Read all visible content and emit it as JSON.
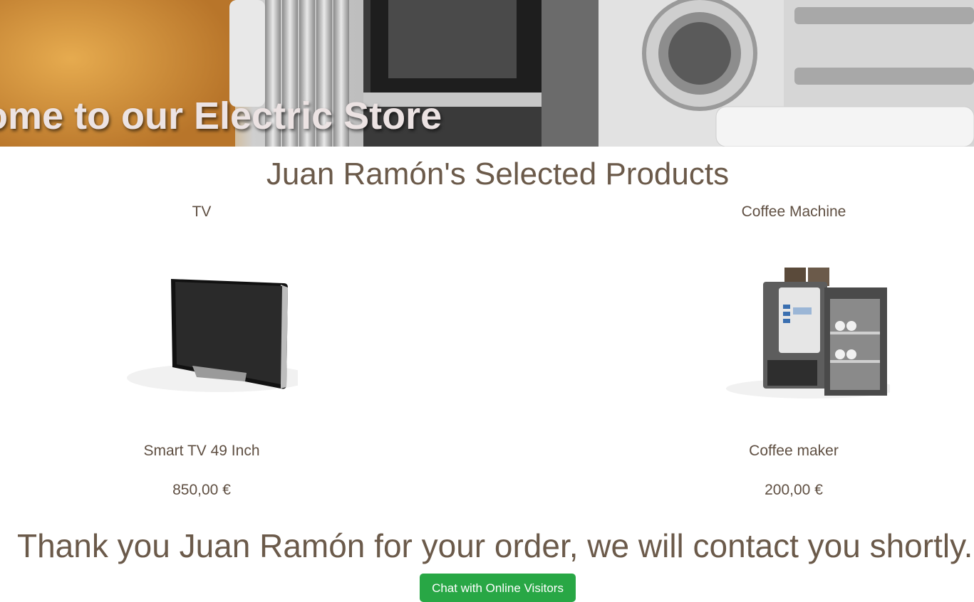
{
  "hero": {
    "title": "ome to our Electric Store"
  },
  "section": {
    "title": "Juan Ramón's Selected Products"
  },
  "products": [
    {
      "category": "TV",
      "name": "Smart TV 49 Inch",
      "price": "850,00 €",
      "icon": "tv-icon"
    },
    {
      "category": "Coffee Machine",
      "name": "Coffee maker",
      "price": "200,00 €",
      "icon": "coffee-machine-icon"
    }
  ],
  "confirmation": {
    "message": "Thank you Juan Ramón for your order, we will contact you shortly."
  },
  "chat": {
    "button_label": "Chat with Online Visitors",
    "color": "#28a745"
  },
  "colors": {
    "text": "#6b5a4a",
    "hero_title": "#ece3e3"
  }
}
